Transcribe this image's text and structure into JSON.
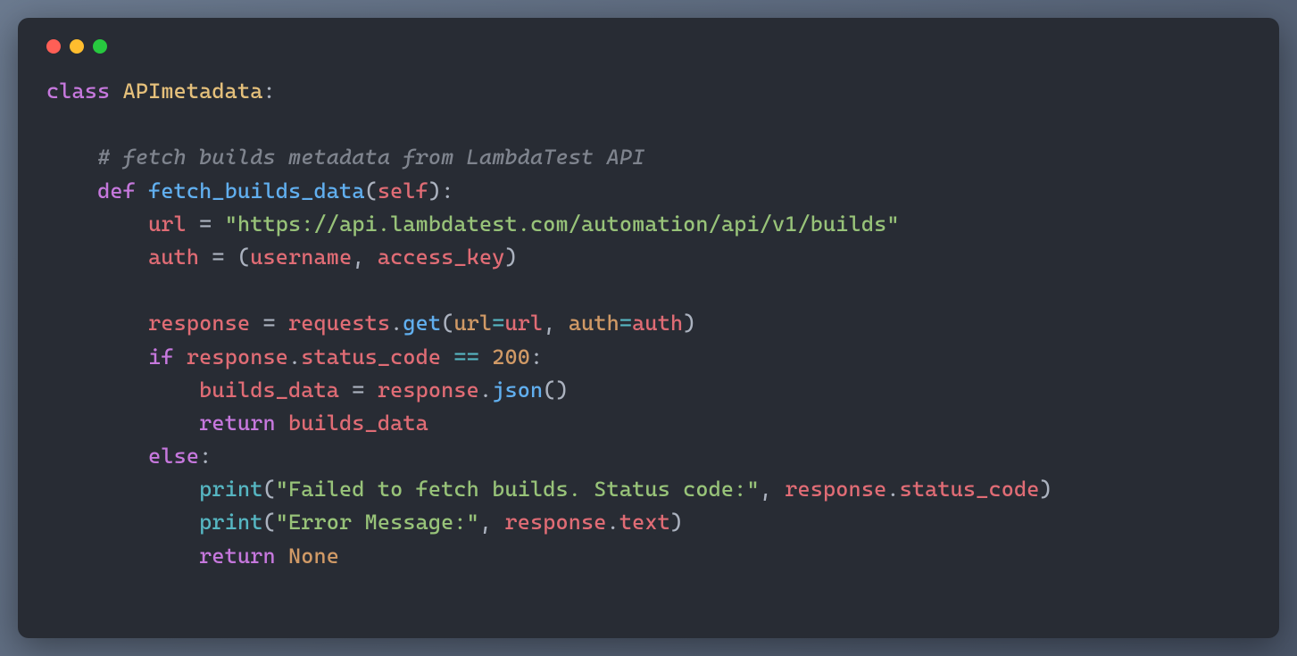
{
  "code": {
    "class_kw": "class",
    "class_name": "APImetadata",
    "colon": ":",
    "comment": "# fetch builds metadata from LambdaTest API",
    "def_kw": "def",
    "func_name": "fetch_builds_data",
    "lparen": "(",
    "rparen": ")",
    "self": "self",
    "url_var": "url",
    "eq": " = ",
    "url_str": "\"https://api.lambdatest.com/automation/api/v1/builds\"",
    "auth_var": "auth",
    "username": "username",
    "access_key": "access_key",
    "comma_sp": ", ",
    "response_var": "response",
    "requests": "requests",
    "dot": ".",
    "get": "get",
    "url_kw": "url",
    "auth_kw": "auth",
    "eq_op": "=",
    "if_kw": "if",
    "status_code": "status_code",
    "eqeq": " == ",
    "n200": "200",
    "builds_data": "builds_data",
    "json": "json",
    "return_kw": "return",
    "else_kw": "else",
    "print": "print",
    "fail_str": "\"Failed to fetch builds. Status code:\"",
    "err_str": "\"Error Message:\"",
    "text": "text",
    "none": "None"
  }
}
